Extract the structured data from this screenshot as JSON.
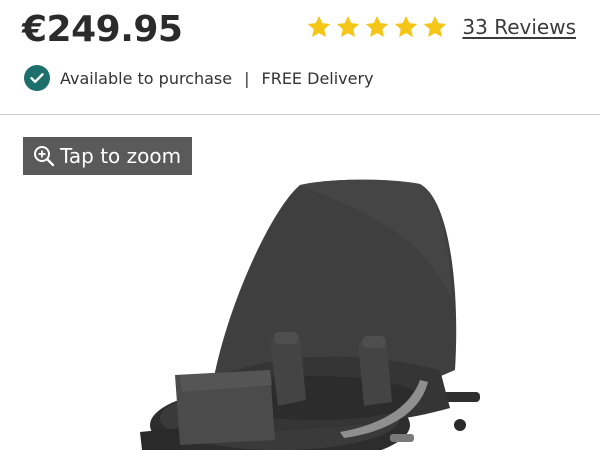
{
  "product": {
    "price": "€249.95",
    "rating": {
      "stars": 5,
      "max_stars": 5,
      "reviews_label": "33 Reviews"
    },
    "availability": {
      "status_text": "Available to purchase",
      "separator": "|",
      "delivery_text": "FREE Delivery"
    }
  },
  "gallery": {
    "zoom_label": "Tap to zoom"
  },
  "colors": {
    "star": "#f5c518",
    "check": "#1d6f6c",
    "zoom_bg": "#5a5a5a"
  }
}
